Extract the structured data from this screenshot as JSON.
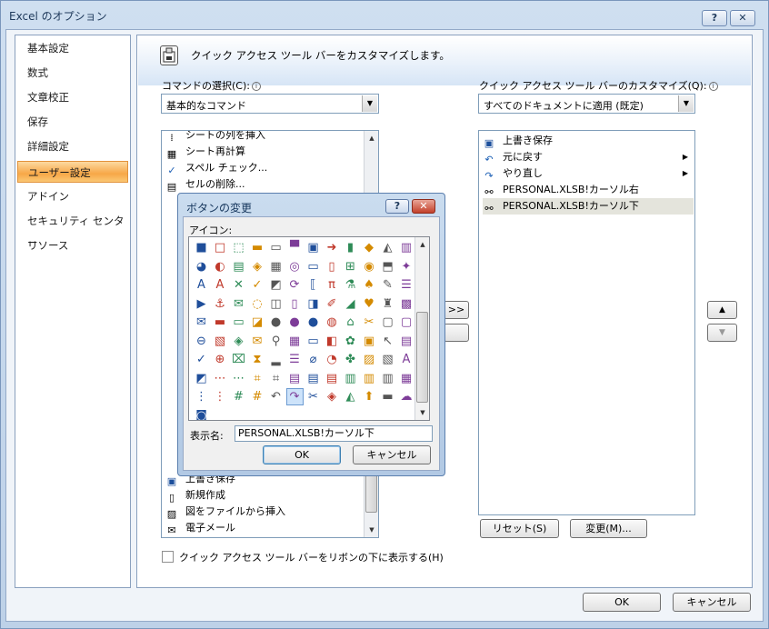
{
  "window": {
    "title": "Excel のオプション",
    "help_label": "?",
    "close_label": "✕"
  },
  "sidebar": {
    "items": [
      {
        "label": "基本設定"
      },
      {
        "label": "数式"
      },
      {
        "label": "文章校正"
      },
      {
        "label": "保存"
      },
      {
        "label": "詳細設定"
      },
      {
        "label": "ユーザー設定",
        "selected": true
      },
      {
        "label": "アドイン"
      },
      {
        "label": "セキュリティ センター"
      },
      {
        "label": "リソース"
      }
    ]
  },
  "header": {
    "text": "クイック アクセス ツール バーをカスタマイズします。"
  },
  "left": {
    "label": "コマンドの選択(C):",
    "combo_value": "基本的なコマンド",
    "list_items": [
      {
        "label": "シートの列を挿入",
        "icon": "insert-column-icon"
      },
      {
        "label": "シート再計算",
        "icon": "calculator-icon"
      },
      {
        "label": "スペル チェック...",
        "icon": "spellcheck-icon"
      },
      {
        "label": "セルの削除...",
        "icon": "delete-cells-icon"
      }
    ],
    "list_items_bottom": [
      {
        "label": "上書き保存",
        "icon": "save-icon"
      },
      {
        "label": "新規作成",
        "icon": "new-document-icon"
      },
      {
        "label": "図をファイルから挿入",
        "icon": "picture-icon"
      },
      {
        "label": "電子メール",
        "icon": "email-icon"
      }
    ]
  },
  "right": {
    "label": "クイック アクセス ツール バーのカスタマイズ(Q):",
    "combo_value": "すべてのドキュメントに適用 (既定)",
    "list_items": [
      {
        "label": "上書き保存",
        "icon": "save-icon"
      },
      {
        "label": "元に戻す",
        "icon": "undo-icon",
        "submenu": true
      },
      {
        "label": "やり直し",
        "icon": "redo-icon",
        "submenu": true
      },
      {
        "label": "PERSONAL.XLSB!カーソル右",
        "icon": "macro-icon"
      },
      {
        "label": "PERSONAL.XLSB!カーソル下",
        "icon": "macro-icon",
        "selected": true
      }
    ],
    "reset_label": "リセット(S)",
    "modify_label": "変更(M)..."
  },
  "move_buttons": {
    "add_label": ">>",
    "up_label": "▲",
    "down_label": "▼"
  },
  "ribbon_checkbox": {
    "label": "クイック アクセス ツール バーをリボンの下に表示する(H)",
    "checked": false
  },
  "footer": {
    "ok_label": "OK",
    "cancel_label": "キャンセル"
  },
  "modal": {
    "title": "ボタンの変更",
    "help_label": "?",
    "close_label": "✕",
    "icon_label": "アイコン:",
    "display_name_label": "表示名:",
    "display_name_value": "PERSONAL.XLSB!カーソル下",
    "ok_label": "OK",
    "cancel_label": "キャンセル",
    "icons": [
      "■",
      "□",
      "⬚",
      "▬",
      "▭",
      "▀",
      "▣",
      "➜",
      "▮",
      "◆",
      "◭",
      "▥",
      "◕",
      "◐",
      "▤",
      "◈",
      "▦",
      "◎",
      "▭",
      "▯",
      "⊞",
      "◉",
      "⬒",
      "✦",
      "A",
      "A",
      "✕",
      "✓",
      "◩",
      "⟳",
      "⟦",
      "π",
      "⚗",
      "♠",
      "✎",
      "☰",
      "▶",
      "⚓",
      "✉",
      "◌",
      "◫",
      "▯",
      "◨",
      "✐",
      "◢",
      "♥",
      "♜",
      "▩",
      "✉",
      "▬",
      "▭",
      "◪",
      "●",
      "●",
      "●",
      "◍",
      "⌂",
      "✂",
      "▢",
      "▢",
      "⊖",
      "▧",
      "◈",
      "✉",
      "⚲",
      "▦",
      "▭",
      "◧",
      "✿",
      "▣",
      "↖",
      "▤",
      "✓",
      "⊕",
      "⌧",
      "⧗",
      "▂",
      "☰",
      "⌀",
      "◔",
      "✤",
      "▨",
      "▧",
      "A",
      "◩",
      "⋯",
      "⋯",
      "⌗",
      "⌗",
      "▤",
      "▤",
      "▤",
      "▥",
      "▥",
      "▥",
      "▦",
      "⋮",
      "⋮",
      "#",
      "#",
      "↶",
      "↷",
      "✂",
      "◈",
      "◭",
      "⬆",
      "▬",
      "☁",
      "◙"
    ]
  }
}
